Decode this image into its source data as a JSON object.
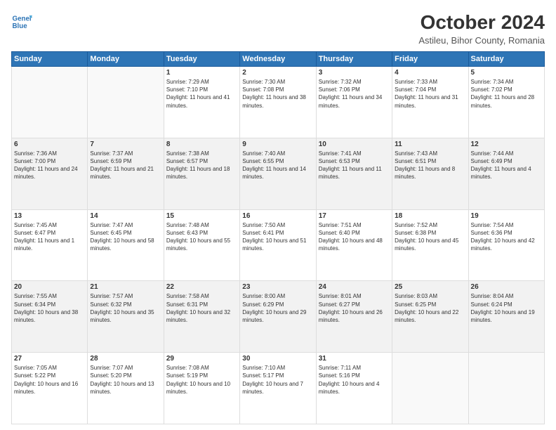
{
  "logo": {
    "line1": "General",
    "line2": "Blue"
  },
  "title": {
    "main": "October 2024",
    "sub": "Astileu, Bihor County, Romania"
  },
  "weekdays": [
    "Sunday",
    "Monday",
    "Tuesday",
    "Wednesday",
    "Thursday",
    "Friday",
    "Saturday"
  ],
  "weeks": [
    [
      {
        "day": "",
        "info": ""
      },
      {
        "day": "",
        "info": ""
      },
      {
        "day": "1",
        "info": "Sunrise: 7:29 AM\nSunset: 7:10 PM\nDaylight: 11 hours and 41 minutes."
      },
      {
        "day": "2",
        "info": "Sunrise: 7:30 AM\nSunset: 7:08 PM\nDaylight: 11 hours and 38 minutes."
      },
      {
        "day": "3",
        "info": "Sunrise: 7:32 AM\nSunset: 7:06 PM\nDaylight: 11 hours and 34 minutes."
      },
      {
        "day": "4",
        "info": "Sunrise: 7:33 AM\nSunset: 7:04 PM\nDaylight: 11 hours and 31 minutes."
      },
      {
        "day": "5",
        "info": "Sunrise: 7:34 AM\nSunset: 7:02 PM\nDaylight: 11 hours and 28 minutes."
      }
    ],
    [
      {
        "day": "6",
        "info": "Sunrise: 7:36 AM\nSunset: 7:00 PM\nDaylight: 11 hours and 24 minutes."
      },
      {
        "day": "7",
        "info": "Sunrise: 7:37 AM\nSunset: 6:59 PM\nDaylight: 11 hours and 21 minutes."
      },
      {
        "day": "8",
        "info": "Sunrise: 7:38 AM\nSunset: 6:57 PM\nDaylight: 11 hours and 18 minutes."
      },
      {
        "day": "9",
        "info": "Sunrise: 7:40 AM\nSunset: 6:55 PM\nDaylight: 11 hours and 14 minutes."
      },
      {
        "day": "10",
        "info": "Sunrise: 7:41 AM\nSunset: 6:53 PM\nDaylight: 11 hours and 11 minutes."
      },
      {
        "day": "11",
        "info": "Sunrise: 7:43 AM\nSunset: 6:51 PM\nDaylight: 11 hours and 8 minutes."
      },
      {
        "day": "12",
        "info": "Sunrise: 7:44 AM\nSunset: 6:49 PM\nDaylight: 11 hours and 4 minutes."
      }
    ],
    [
      {
        "day": "13",
        "info": "Sunrise: 7:45 AM\nSunset: 6:47 PM\nDaylight: 11 hours and 1 minute."
      },
      {
        "day": "14",
        "info": "Sunrise: 7:47 AM\nSunset: 6:45 PM\nDaylight: 10 hours and 58 minutes."
      },
      {
        "day": "15",
        "info": "Sunrise: 7:48 AM\nSunset: 6:43 PM\nDaylight: 10 hours and 55 minutes."
      },
      {
        "day": "16",
        "info": "Sunrise: 7:50 AM\nSunset: 6:41 PM\nDaylight: 10 hours and 51 minutes."
      },
      {
        "day": "17",
        "info": "Sunrise: 7:51 AM\nSunset: 6:40 PM\nDaylight: 10 hours and 48 minutes."
      },
      {
        "day": "18",
        "info": "Sunrise: 7:52 AM\nSunset: 6:38 PM\nDaylight: 10 hours and 45 minutes."
      },
      {
        "day": "19",
        "info": "Sunrise: 7:54 AM\nSunset: 6:36 PM\nDaylight: 10 hours and 42 minutes."
      }
    ],
    [
      {
        "day": "20",
        "info": "Sunrise: 7:55 AM\nSunset: 6:34 PM\nDaylight: 10 hours and 38 minutes."
      },
      {
        "day": "21",
        "info": "Sunrise: 7:57 AM\nSunset: 6:32 PM\nDaylight: 10 hours and 35 minutes."
      },
      {
        "day": "22",
        "info": "Sunrise: 7:58 AM\nSunset: 6:31 PM\nDaylight: 10 hours and 32 minutes."
      },
      {
        "day": "23",
        "info": "Sunrise: 8:00 AM\nSunset: 6:29 PM\nDaylight: 10 hours and 29 minutes."
      },
      {
        "day": "24",
        "info": "Sunrise: 8:01 AM\nSunset: 6:27 PM\nDaylight: 10 hours and 26 minutes."
      },
      {
        "day": "25",
        "info": "Sunrise: 8:03 AM\nSunset: 6:25 PM\nDaylight: 10 hours and 22 minutes."
      },
      {
        "day": "26",
        "info": "Sunrise: 8:04 AM\nSunset: 6:24 PM\nDaylight: 10 hours and 19 minutes."
      }
    ],
    [
      {
        "day": "27",
        "info": "Sunrise: 7:05 AM\nSunset: 5:22 PM\nDaylight: 10 hours and 16 minutes."
      },
      {
        "day": "28",
        "info": "Sunrise: 7:07 AM\nSunset: 5:20 PM\nDaylight: 10 hours and 13 minutes."
      },
      {
        "day": "29",
        "info": "Sunrise: 7:08 AM\nSunset: 5:19 PM\nDaylight: 10 hours and 10 minutes."
      },
      {
        "day": "30",
        "info": "Sunrise: 7:10 AM\nSunset: 5:17 PM\nDaylight: 10 hours and 7 minutes."
      },
      {
        "day": "31",
        "info": "Sunrise: 7:11 AM\nSunset: 5:16 PM\nDaylight: 10 hours and 4 minutes."
      },
      {
        "day": "",
        "info": ""
      },
      {
        "day": "",
        "info": ""
      }
    ]
  ]
}
